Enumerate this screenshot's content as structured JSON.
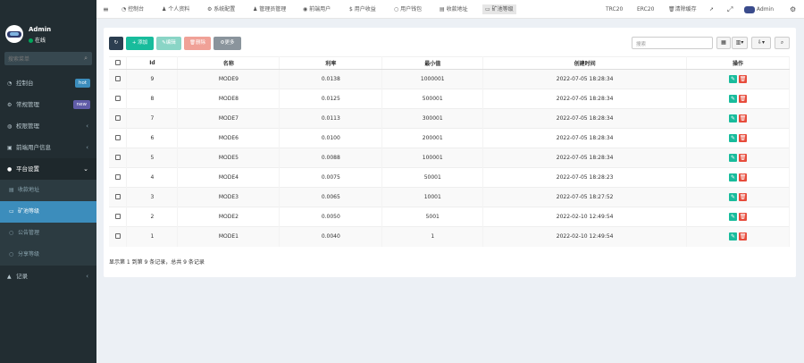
{
  "user": {
    "name": "Admin",
    "status": "在线"
  },
  "sidebar": {
    "search_placeholder": "搜索菜单",
    "items": [
      {
        "label": "控制台",
        "badge": "hot",
        "badge_color": "#3c8dbc"
      },
      {
        "label": "常规管理",
        "badge": "new",
        "badge_color": "#605ca8"
      },
      {
        "label": "权限管理"
      },
      {
        "label": "前端用户信息"
      },
      {
        "label": "平台设置"
      }
    ],
    "sub_items": [
      {
        "label": "收款地址"
      },
      {
        "label": "矿池等级"
      },
      {
        "label": "公告管理"
      },
      {
        "label": "分享等级"
      }
    ],
    "last_item": {
      "label": "记录"
    }
  },
  "topnav": {
    "tabs": [
      "控制台",
      "个人资料",
      "系统配置",
      "管理员管理",
      "前端用户",
      "用户收益",
      "用户钱包",
      "收款地址",
      "矿池等级"
    ],
    "right": [
      "TRC20",
      "ERC20",
      "清除缓存",
      "Admin"
    ]
  },
  "toolbar": {
    "add": "添加",
    "edit": "编辑",
    "delete": "删除",
    "more": "更多",
    "search_placeholder": "搜索"
  },
  "table": {
    "columns": [
      "Id",
      "名称",
      "利率",
      "最小值",
      "创建时间",
      "操作"
    ],
    "rows": [
      [
        "9",
        "MODE9",
        "0.0138",
        "1000001",
        "2022-07-05 18:28:34"
      ],
      [
        "8",
        "MODE8",
        "0.0125",
        "500001",
        "2022-07-05 18:28:34"
      ],
      [
        "7",
        "MODE7",
        "0.0113",
        "300001",
        "2022-07-05 18:28:34"
      ],
      [
        "6",
        "MODE6",
        "0.0100",
        "200001",
        "2022-07-05 18:28:34"
      ],
      [
        "5",
        "MODE5",
        "0.0088",
        "100001",
        "2022-07-05 18:28:34"
      ],
      [
        "4",
        "MODE4",
        "0.0075",
        "50001",
        "2022-07-05 18:28:23"
      ],
      [
        "3",
        "MODE3",
        "0.0065",
        "10001",
        "2022-07-05 18:27:52"
      ],
      [
        "2",
        "MODE2",
        "0.0050",
        "5001",
        "2022-02-10 12:49:54"
      ],
      [
        "1",
        "MODE1",
        "0.0040",
        "1",
        "2022-02-10 12:49:54"
      ]
    ]
  },
  "footer": "显示第 1 到第 9 条记录，总共 9 条记录",
  "colors": {
    "sidebar": "#222d32",
    "active": "#3c8dbc",
    "success": "#18bc9c",
    "danger": "#e74c3c"
  }
}
